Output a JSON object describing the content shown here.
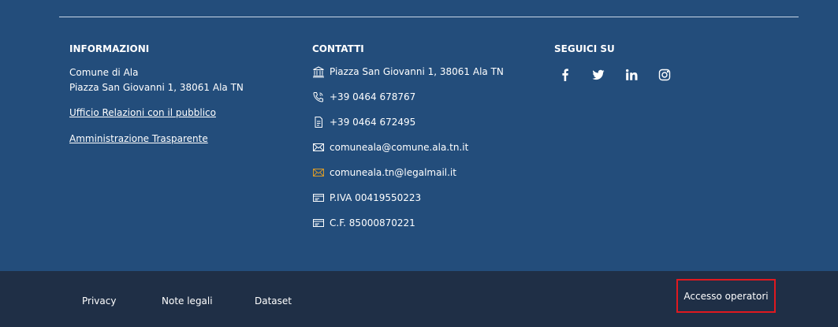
{
  "informazioni": {
    "title": "INFORMAZIONI",
    "line1": "Comune di Ala",
    "line2": "Piazza San Giovanni 1, 38061 Ala TN",
    "link1": "Ufficio Relazioni con il pubblico",
    "link2": "Amministrazione Trasparente"
  },
  "contatti": {
    "title": "CONTATTI",
    "address": "Piazza San Giovanni 1, 38061 Ala TN",
    "phone": "+39 0464 678767",
    "fax": "+39 0464 672495",
    "email": "comuneala@comune.ala.tn.it",
    "pec": "comuneala.tn@legalmail.it",
    "piva": "P.IVA 00419550223",
    "cf": "C.F. 85000870221"
  },
  "social": {
    "title": "SEGUICI SU",
    "icons": [
      "facebook-icon",
      "twitter-icon",
      "linkedin-icon",
      "instagram-icon"
    ]
  },
  "bottom": {
    "privacy": "Privacy",
    "note_legali": "Note legali",
    "dataset": "Dataset",
    "accesso_operatori": "Accesso operatori"
  },
  "colors": {
    "main_bg": "#234d7b",
    "bottom_bg": "#1f2f46",
    "highlight_border": "#e0191f",
    "pec_icon": "#d79a2a"
  }
}
